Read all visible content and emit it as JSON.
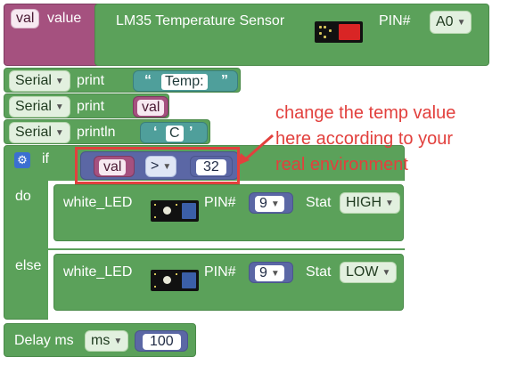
{
  "var_block": {
    "var_name": "val",
    "label_value": "value",
    "sensor_name": "LM35 Temperature Sensor",
    "pin_label": "PIN#",
    "pin_value": "A0"
  },
  "serial1": {
    "port": "Serial",
    "action": "print",
    "open_quote": "“",
    "text": "Temp:",
    "close_quote": "”"
  },
  "serial2": {
    "port": "Serial",
    "action": "print",
    "var": "val"
  },
  "serial3": {
    "port": "Serial",
    "action": "println",
    "open_quote": "‘",
    "text": "C",
    "close_quote": "’"
  },
  "if_block": {
    "if_label": "if",
    "cond_var": "val",
    "operator": ">",
    "threshold": "32",
    "do_label": "do",
    "else_label": "else"
  },
  "do_led": {
    "name": "white_LED",
    "pin_label": "PIN#",
    "pin": "9",
    "stat_label": "Stat",
    "stat": "HIGH"
  },
  "else_led": {
    "name": "white_LED",
    "pin_label": "PIN#",
    "pin": "9",
    "stat_label": "Stat",
    "stat": "LOW"
  },
  "delay": {
    "label": "Delay ms",
    "unit": "ms",
    "value": "100"
  },
  "annotation": {
    "line1": "change the temp value",
    "line2": "here according to your",
    "line3": "real environment",
    "color": "#e2403d"
  },
  "colors": {
    "var_block": "#a5517f",
    "statement": "#5ba15a",
    "serial_string": "#4f9f9b",
    "compare": "#5b67a5",
    "if_icon": "#3b6fd1"
  }
}
